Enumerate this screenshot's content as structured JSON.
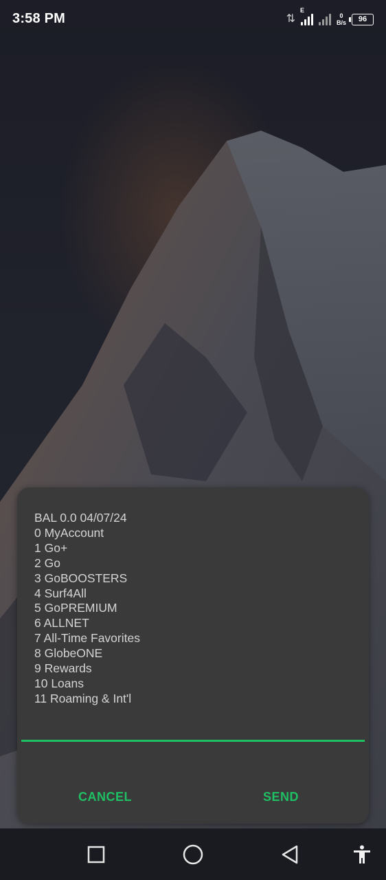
{
  "status_bar": {
    "time": "3:58 PM",
    "network_type": "E",
    "net_speed_value": "0",
    "net_speed_unit": "B/s",
    "battery_level": "96"
  },
  "ussd_dialog": {
    "lines": [
      "BAL 0.0 04/07/24",
      "0 MyAccount",
      "1 Go+",
      "2 Go",
      "3 GoBOOSTERS",
      "4 Surf4All",
      "5 GoPREMIUM",
      "6 ALLNET",
      "7 All-Time Favorites",
      "8 GlobeONE",
      "9 Rewards",
      "10 Loans",
      "11 Roaming & Int'l"
    ],
    "input_value": "",
    "cancel_label": "CANCEL",
    "send_label": "SEND"
  },
  "colors": {
    "accent": "#1ec063",
    "dialog_background": "#3a3a3b",
    "text": "#d4d4d4"
  },
  "navigation_bar": {
    "icons": [
      "recents-icon",
      "home-icon",
      "back-icon",
      "accessibility-icon"
    ]
  }
}
